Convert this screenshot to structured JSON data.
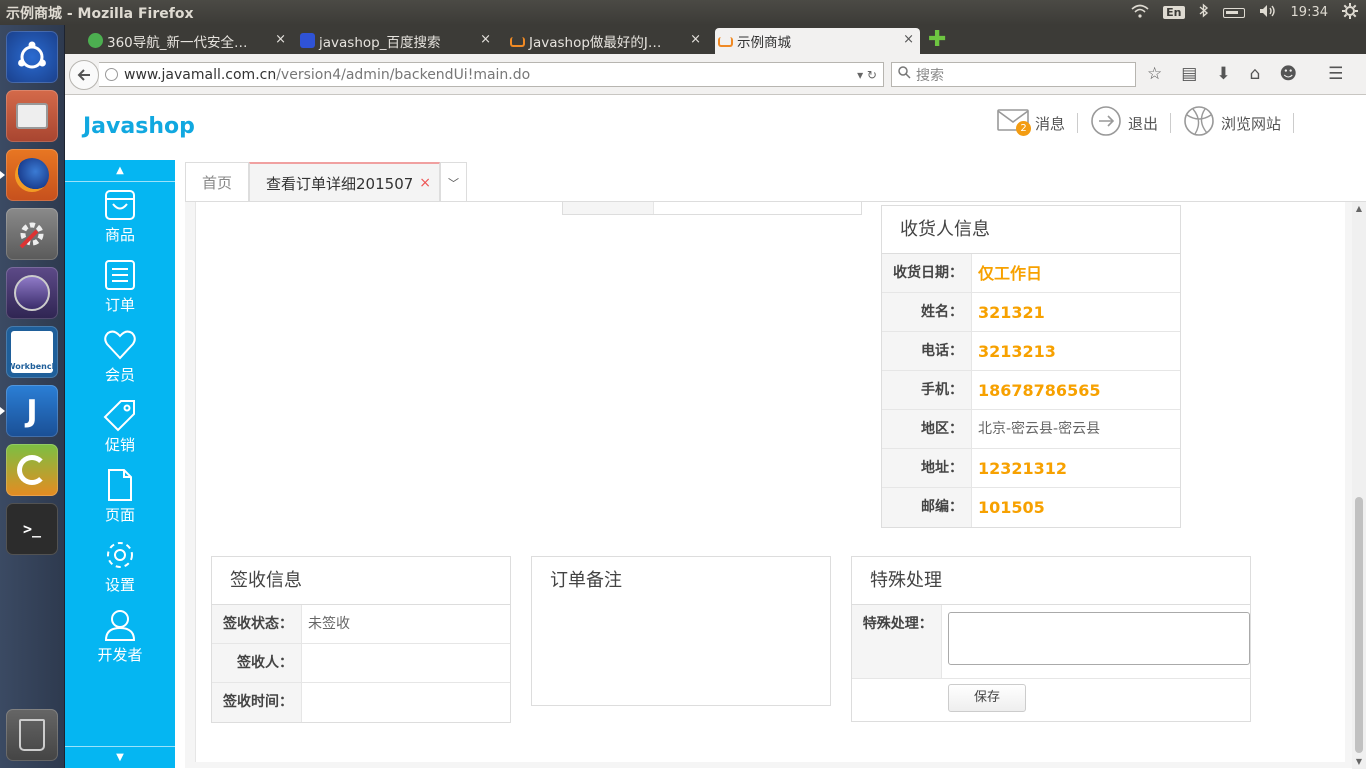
{
  "window": {
    "title": "示例商城 - Mozilla Firefox"
  },
  "system_tray": {
    "input_method": "En",
    "clock": "19:34"
  },
  "launcher": {
    "apps": [
      {
        "name": "ubuntu-dash"
      },
      {
        "name": "files"
      },
      {
        "name": "firefox"
      },
      {
        "name": "system-settings"
      },
      {
        "name": "eclipse"
      },
      {
        "name": "mysql-workbench",
        "label": "Workbench"
      },
      {
        "name": "intellij",
        "label": "J"
      },
      {
        "name": "pycharm"
      },
      {
        "name": "terminal",
        "label": ">_"
      },
      {
        "name": "trash"
      }
    ]
  },
  "browser": {
    "tabs": [
      {
        "label": "360导航_新一代安全…",
        "fav_color": "#4caf50"
      },
      {
        "label": "javashop_百度搜索",
        "fav_color": "#2f53d6"
      },
      {
        "label": "Javashop做最好的J…",
        "fav_color": "#f08a24"
      },
      {
        "label": "示例商城",
        "fav_color": "#f08a24"
      }
    ],
    "tab_close": "×",
    "new_tab": "✚",
    "url_host": "www.javamall.com.cn",
    "url_path": "/version4/admin/backendUi!main.do",
    "search_placeholder": "搜索"
  },
  "app": {
    "logo": "Javashop",
    "header_links": {
      "messages": "消息",
      "message_count": "2",
      "logout": "退出",
      "browse_site": "浏览网站"
    },
    "nav": [
      {
        "label": "商品",
        "icon": "bag-icon"
      },
      {
        "label": "订单",
        "icon": "list-icon"
      },
      {
        "label": "会员",
        "icon": "heart-icon"
      },
      {
        "label": "促销",
        "icon": "tag-icon"
      },
      {
        "label": "页面",
        "icon": "page-icon"
      },
      {
        "label": "设置",
        "icon": "gear-icon"
      },
      {
        "label": "开发者",
        "icon": "user-icon"
      }
    ],
    "page_tabs": {
      "home": "首页",
      "active": "查看订单详细201507",
      "close": "×",
      "dropdown": "﹀"
    },
    "receiver": {
      "title": "收货人信息",
      "rows": [
        {
          "label": "收货日期：",
          "value": "仅工作日",
          "highlight": true
        },
        {
          "label": "姓名：",
          "value": "321321",
          "highlight": true
        },
        {
          "label": "电话：",
          "value": "3213213",
          "highlight": true
        },
        {
          "label": "手机：",
          "value": "18678786565",
          "highlight": true
        },
        {
          "label": "地区：",
          "value": "北京-密云县-密云县",
          "highlight": false
        },
        {
          "label": "地址：",
          "value": "12321312",
          "highlight": true
        },
        {
          "label": "邮编：",
          "value": "101505",
          "highlight": true
        }
      ]
    },
    "sign_info": {
      "title": "签收信息",
      "rows": [
        {
          "label": "签收状态：",
          "value": "未签收"
        },
        {
          "label": "签收人：",
          "value": ""
        },
        {
          "label": "签收时间：",
          "value": ""
        }
      ]
    },
    "order_note": {
      "title": "订单备注"
    },
    "special": {
      "title": "特殊处理",
      "label": "特殊处理：",
      "textarea_value": "",
      "save": "保存"
    },
    "accent_color": "#05b6f2",
    "highlight_color": "#f7a100"
  }
}
